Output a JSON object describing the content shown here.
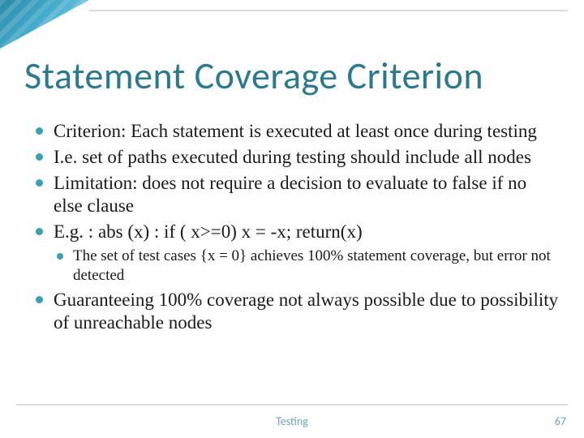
{
  "title": "Statement Coverage Criterion",
  "bullets": [
    {
      "text": "Criterion: Each statement is executed at least once during testing"
    },
    {
      "text": "I.e. set of paths executed during testing should include all nodes"
    },
    {
      "text": "Limitation: does not require a decision to evaluate to false if no else clause"
    },
    {
      "text": "E.g. :  abs (x) : if ( x>=0) x = -x; return(x)",
      "sub": [
        {
          "text": "The set of test cases {x = 0} achieves 100% statement coverage, but error not detected"
        }
      ]
    },
    {
      "text": "Guaranteeing 100% coverage not always possible due to possibility of unreachable nodes"
    }
  ],
  "footer": {
    "label": "Testing",
    "page": "67"
  },
  "colors": {
    "accent": "#2a7a8f",
    "bullet": "#3aa0b8",
    "rule": "#dcdcdc"
  }
}
